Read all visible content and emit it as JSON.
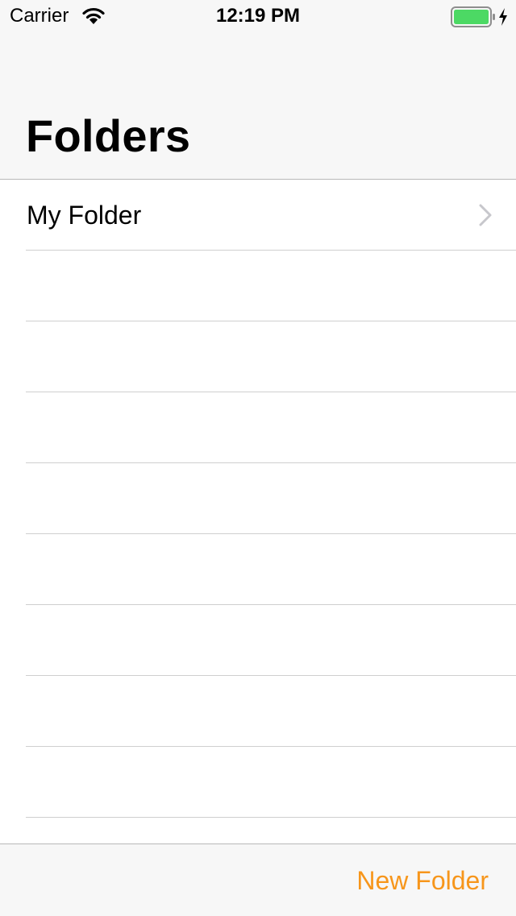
{
  "status_bar": {
    "carrier": "Carrier",
    "time": "12:19 PM",
    "wifi_icon": "wifi-icon",
    "battery_icon": "battery-icon",
    "battery_level": 1.0,
    "charging_icon": "bolt-icon"
  },
  "nav": {
    "title": "Folders"
  },
  "folders": [
    {
      "label": "My Folder",
      "icon": "chevron-right-icon"
    },
    {
      "label": ""
    },
    {
      "label": ""
    },
    {
      "label": ""
    },
    {
      "label": ""
    },
    {
      "label": ""
    },
    {
      "label": ""
    },
    {
      "label": ""
    },
    {
      "label": ""
    },
    {
      "label": ""
    }
  ],
  "toolbar": {
    "new_folder_label": "New Folder"
  },
  "colors": {
    "accent": "#f7961b",
    "battery_fill": "#4cd964",
    "bar_background": "#f7f7f7",
    "separator": "#cfcfcf"
  }
}
